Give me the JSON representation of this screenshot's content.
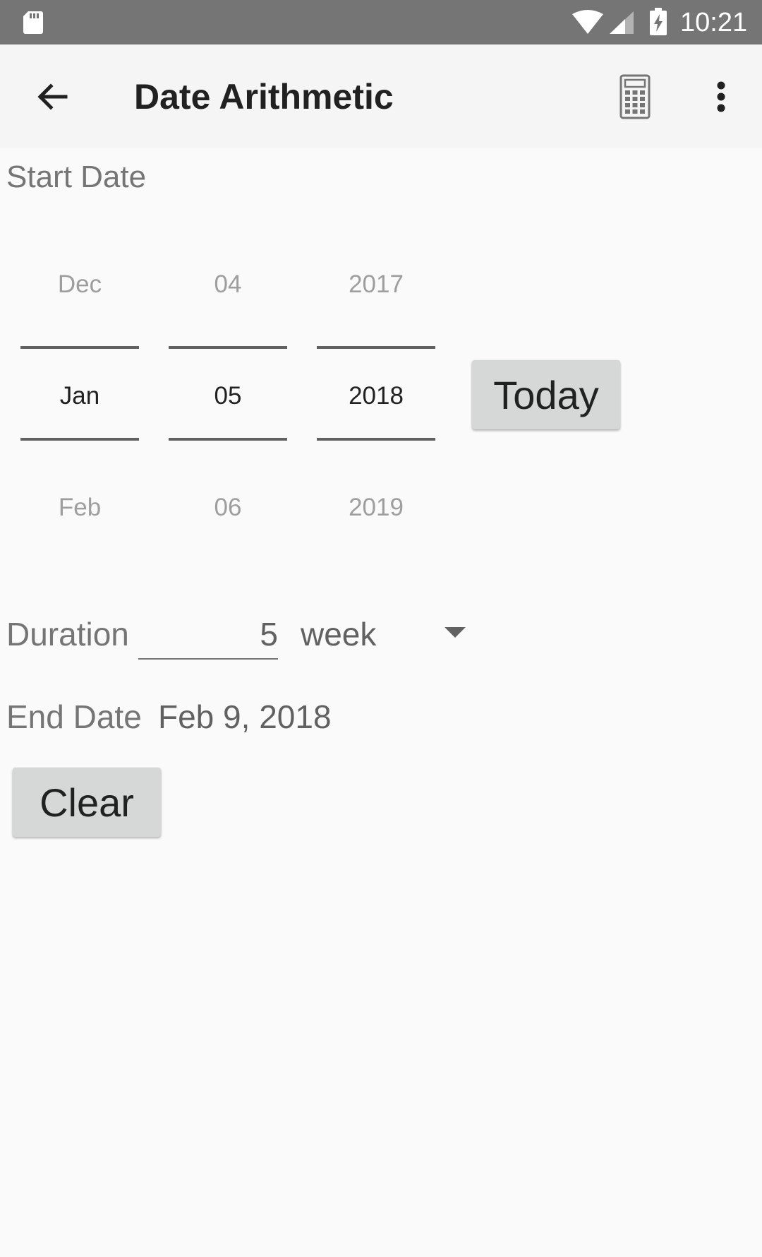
{
  "status_bar": {
    "time": "10:21",
    "icons": [
      "sd-card-icon",
      "wifi-icon",
      "cell-signal-icon",
      "battery-charging-icon"
    ]
  },
  "toolbar": {
    "title": "Date Arithmetic",
    "back_icon": "arrow-back-icon",
    "calculator_icon": "calculator-icon",
    "more_icon": "more-vert-icon"
  },
  "start_date": {
    "label": "Start Date",
    "month": {
      "prev": "Dec",
      "current": "Jan",
      "next": "Feb"
    },
    "day": {
      "prev": "04",
      "current": "05",
      "next": "06"
    },
    "year": {
      "prev": "2017",
      "current": "2018",
      "next": "2019"
    },
    "today_button": "Today"
  },
  "duration": {
    "label": "Duration",
    "value": "5",
    "unit": "week"
  },
  "end_date": {
    "label": "End Date",
    "value": "Feb 9, 2018"
  },
  "clear_button": "Clear",
  "colors": {
    "status_bar": "#757575",
    "toolbar": "#f5f5f5",
    "background": "#fafafa",
    "button": "#d6d7d7"
  }
}
